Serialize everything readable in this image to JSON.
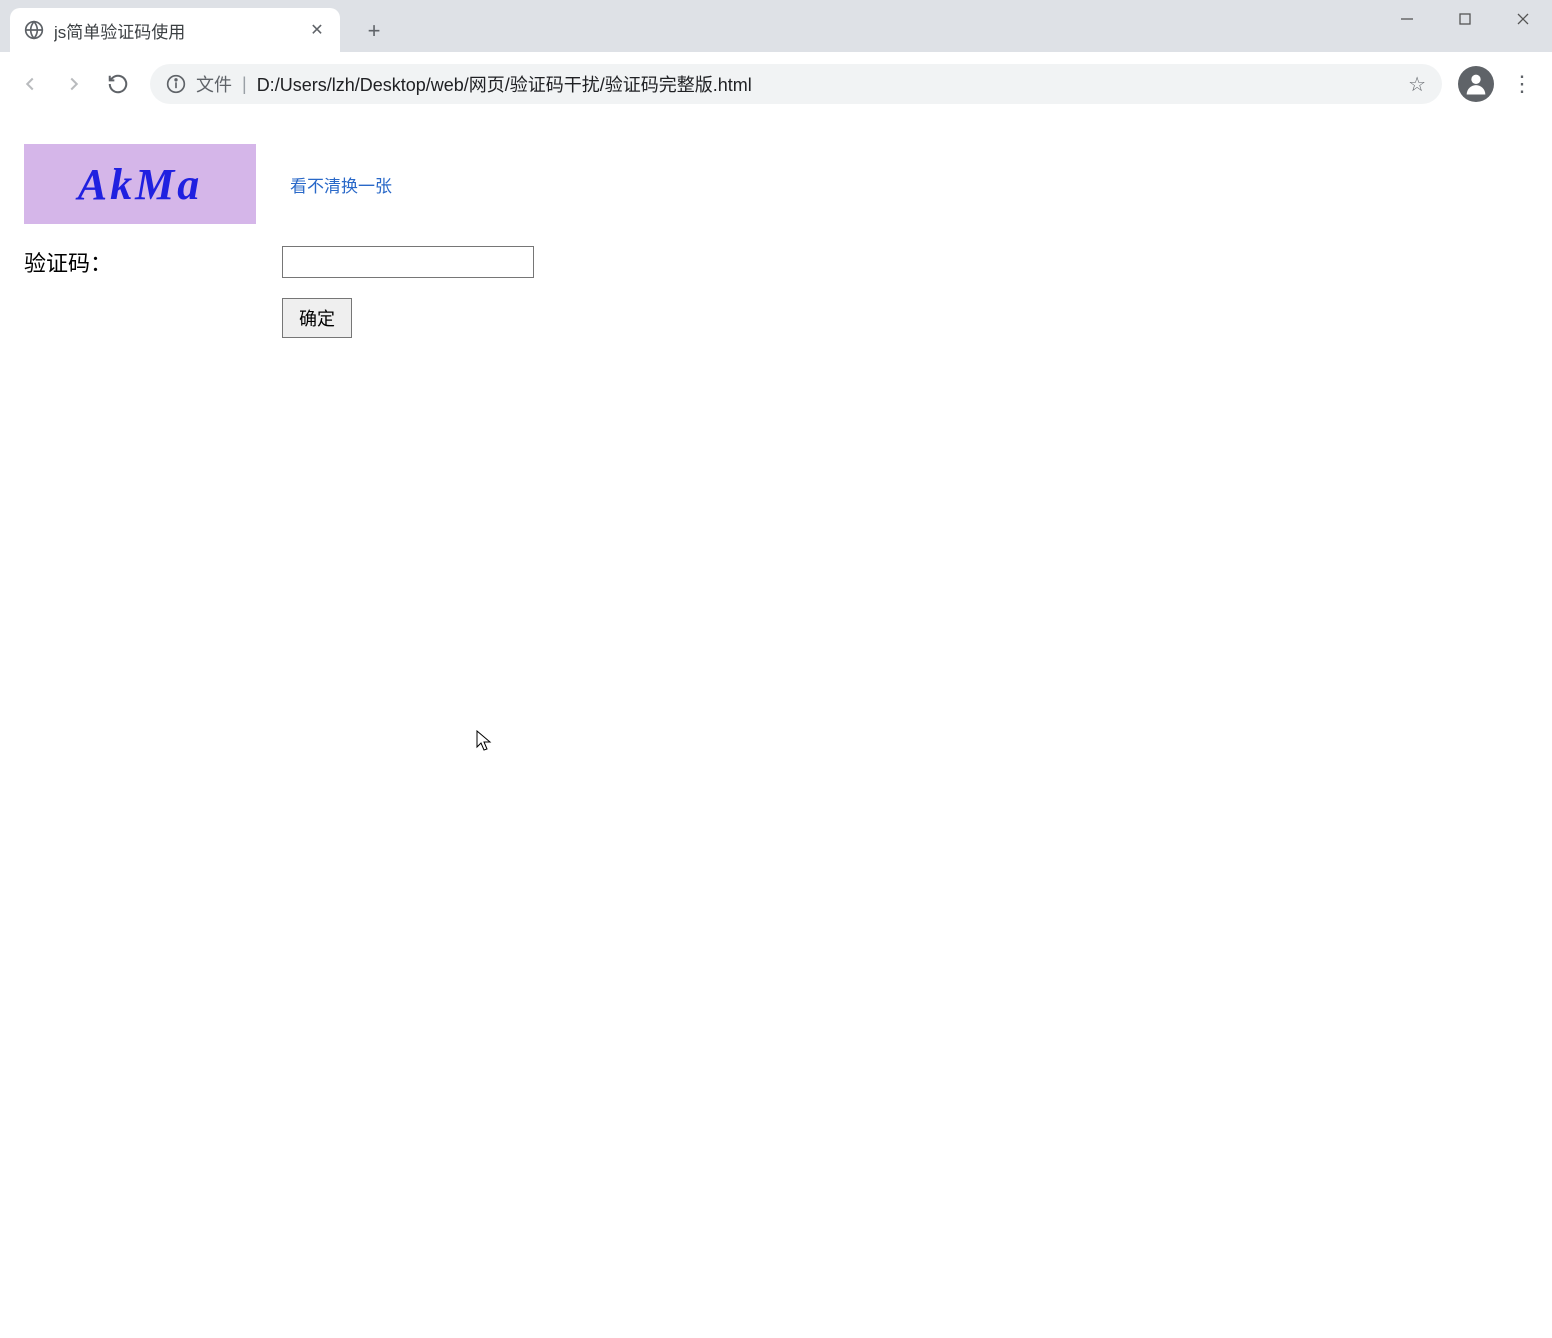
{
  "browser": {
    "tab_title": "js简单验证码使用",
    "url_prefix": "文件",
    "url": "D:/Users/lzh/Desktop/web/网页/验证码干扰/验证码完整版.html"
  },
  "page": {
    "captcha_text": "AkMa",
    "refresh_link": "看不清换一张",
    "input_label": "验证码：",
    "input_value": "",
    "submit_label": "确定"
  }
}
